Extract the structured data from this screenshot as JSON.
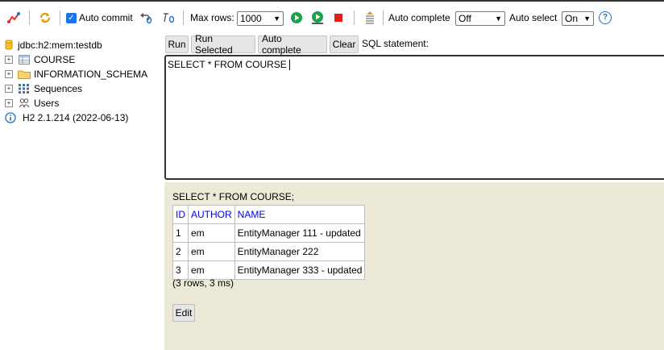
{
  "toolbar": {
    "auto_commit_label": "Auto commit",
    "max_rows_label": "Max rows:",
    "max_rows_value": "1000",
    "auto_complete_label": "Auto complete",
    "auto_complete_value": "Off",
    "auto_select_label": "Auto select",
    "auto_select_value": "On",
    "help_glyph": "?",
    "icons": [
      "disconnect-icon",
      "refresh-icon",
      "rollback-icon",
      "commit-icon",
      "run-icon",
      "run-selected-icon",
      "stop-icon",
      "history-icon",
      "help-icon"
    ],
    "colors": {
      "run": "#1aa34a",
      "stop": "#e02020",
      "accent": "#1f6fc5"
    }
  },
  "tree": {
    "connection": "jdbc:h2:mem:testdb",
    "items": [
      {
        "label": "COURSE",
        "icon": "table-icon"
      },
      {
        "label": "INFORMATION_SCHEMA",
        "icon": "folder-icon"
      },
      {
        "label": "Sequences",
        "icon": "sequences-icon"
      },
      {
        "label": "Users",
        "icon": "users-icon"
      }
    ],
    "version": "H2 2.1.214 (2022-06-13)"
  },
  "buttons": {
    "run": "Run",
    "run_selected": "Run Selected",
    "auto_complete": "Auto complete",
    "clear": "Clear"
  },
  "sql_label": "SQL statement:",
  "editor_text": "SELECT * FROM COURSE",
  "result": {
    "statement": "SELECT * FROM COURSE;",
    "columns": [
      "ID",
      "AUTHOR",
      "NAME"
    ],
    "rows": [
      [
        "1",
        "em",
        "EntityManager 111 - updated"
      ],
      [
        "2",
        "em",
        "EntityManager 222"
      ],
      [
        "3",
        "em",
        "EntityManager 333 - updated"
      ]
    ],
    "row_count": "(3 rows, 3 ms)",
    "edit_label": "Edit"
  }
}
